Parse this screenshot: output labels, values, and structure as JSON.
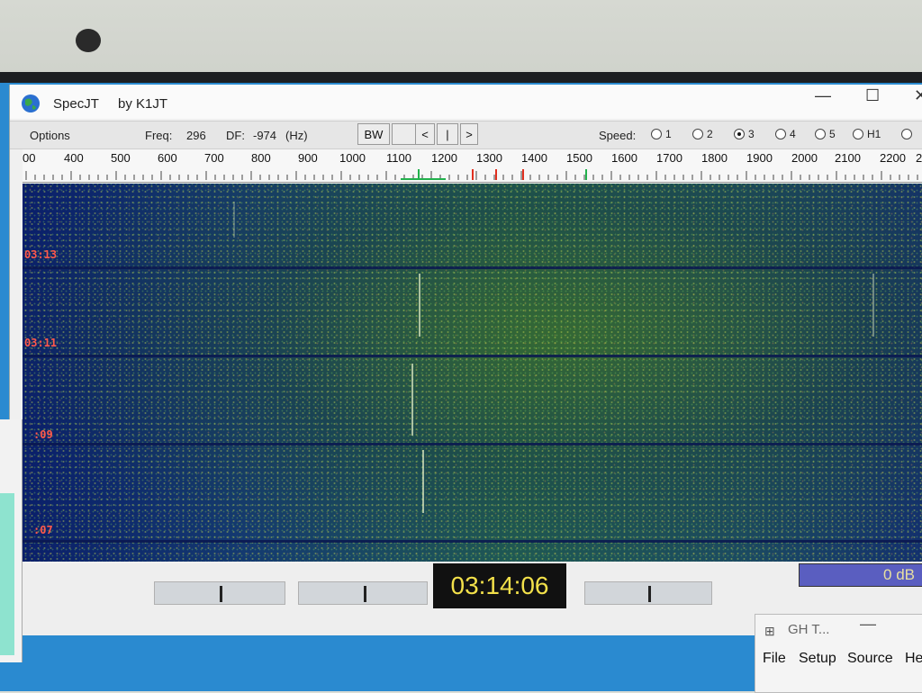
{
  "window": {
    "title": "SpecJT",
    "byline": "by K1JT",
    "controls": {
      "minimize": "—",
      "maximize": "☐",
      "close": "✕"
    }
  },
  "toolbar": {
    "options_label": "Options",
    "freq_label": "Freq:",
    "freq_value": "296",
    "df_label": "DF:",
    "df_value": "-974",
    "df_unit": "(Hz)",
    "bw_label": "BW",
    "nav_prev": "<",
    "nav_center": "|",
    "nav_next": ">",
    "speed_label": "Speed:",
    "speed_options": [
      "1",
      "2",
      "3",
      "4",
      "5",
      "H1"
    ],
    "speed_selected": "3"
  },
  "ruler": {
    "labels": [
      "00",
      "400",
      "500",
      "600",
      "700",
      "800",
      "900",
      "1000",
      "1100",
      "1200",
      "1300",
      "1400",
      "1500",
      "1600",
      "1700",
      "1800",
      "1900",
      "2000",
      "2100",
      "2200",
      "2"
    ],
    "marker_colors": {
      "green": "#22b14c",
      "red": "#e03020"
    }
  },
  "waterfall": {
    "time_labels": [
      "03:13",
      "03:11",
      ":09",
      ":07"
    ],
    "label_color": "#ff5a4a"
  },
  "status": {
    "clock": "03:14:06",
    "level": "0 dB"
  },
  "secondary_window": {
    "title": "GH T...",
    "menu": [
      "File",
      "Setup",
      "Source",
      "He"
    ]
  }
}
